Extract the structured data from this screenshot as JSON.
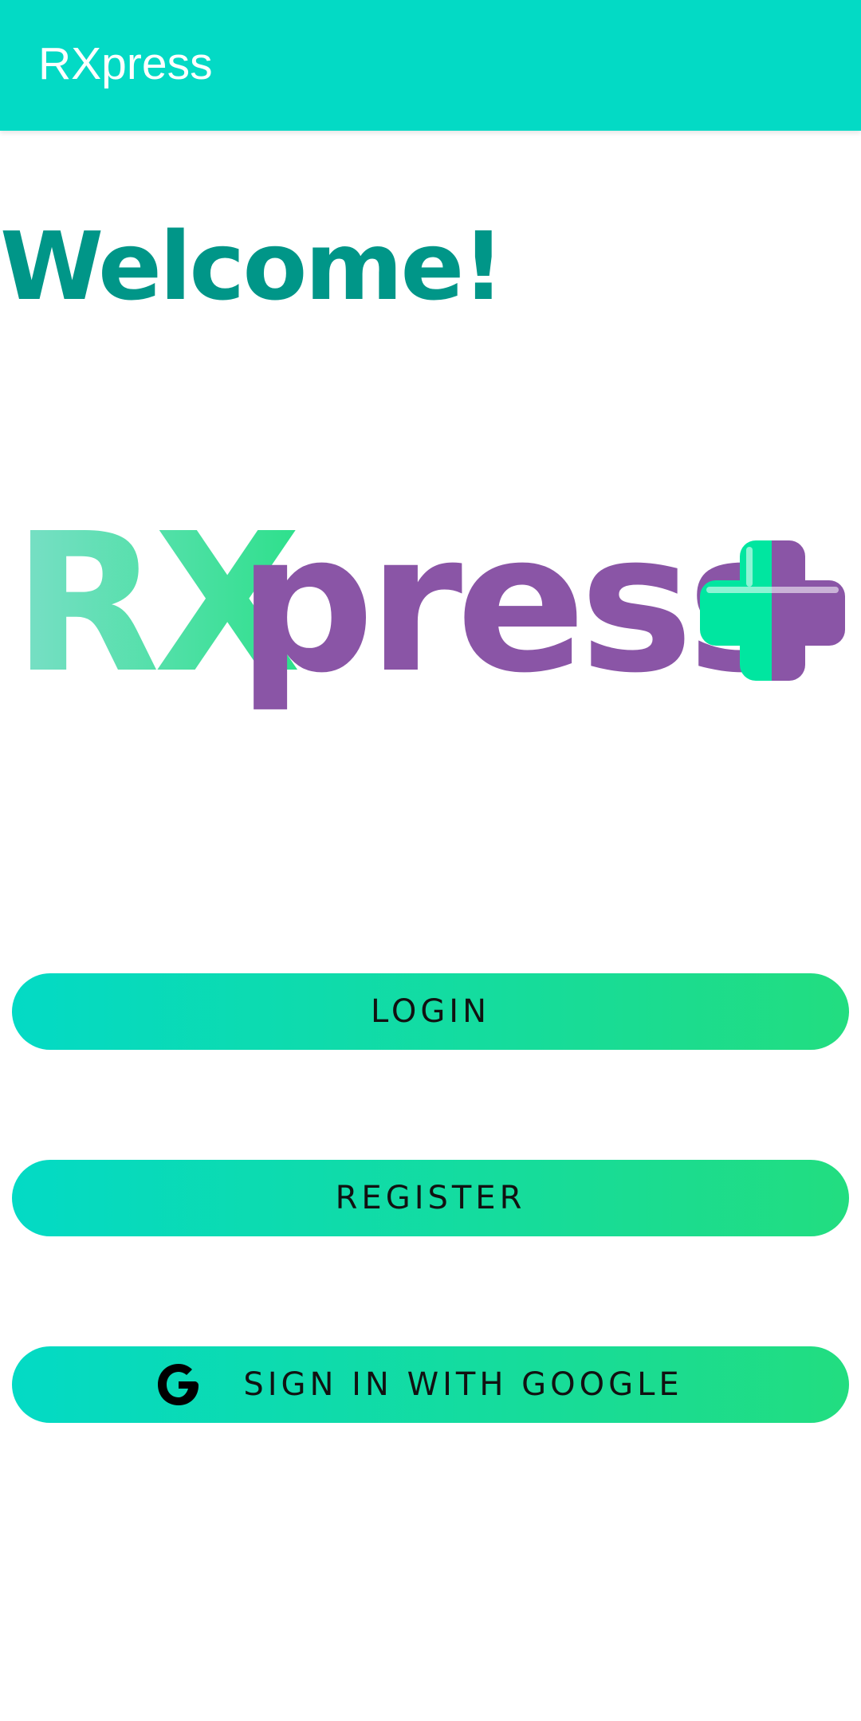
{
  "app_bar": {
    "title": "RXpress"
  },
  "main": {
    "welcome": "Welcome!",
    "logo": {
      "text_rx": "RX",
      "text_press": "press",
      "icon": "medical-cross-icon"
    }
  },
  "buttons": {
    "login": "LOGIN",
    "register": "REGISTER",
    "google": "SIGN IN WITH GOOGLE"
  },
  "colors": {
    "app_bar": "#03DAC5",
    "welcome_text": "#009688",
    "button_gradient_start": "#03DAC5",
    "button_gradient_end": "#22DD80",
    "logo_green": "#00E6A0",
    "logo_purple": "#8A55A6"
  }
}
